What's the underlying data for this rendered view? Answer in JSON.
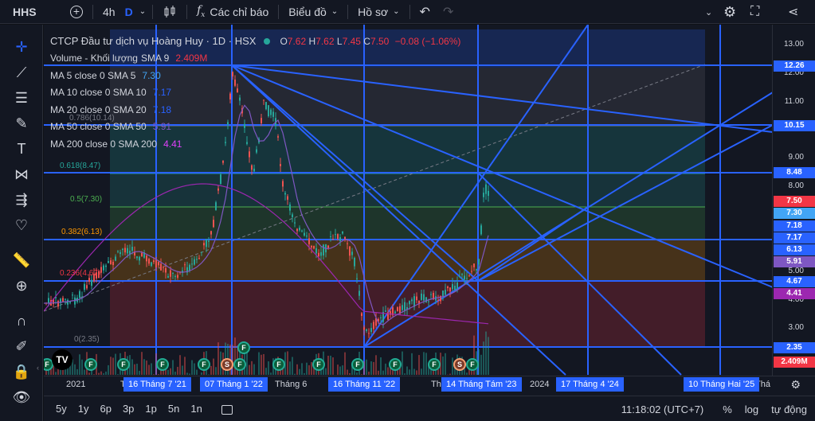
{
  "topbar": {
    "symbol": "HHS",
    "add_icon": "plus-circle-icon",
    "interval": "4h",
    "interval_d": "D",
    "indicators_label": "Các chỉ báo",
    "chart_type_label": "Biểu đồ",
    "profile_label": "Hồ sơ"
  },
  "legend": {
    "title": "CTCP Đầu tư dịch vụ Hoàng Huy · 1D · HSX",
    "ohlc": {
      "O": "7.62",
      "H": "7.62",
      "L": "7.45",
      "C": "7.50",
      "chg": "−0.08 (−1.06%)"
    },
    "volume": {
      "name": "Volume - Khối lượng",
      "sma": "SMA 9",
      "value": "2.409M"
    },
    "ma": [
      {
        "name": "MA 5 close 0 SMA 5",
        "value": "7.30",
        "color": "#42a5f5"
      },
      {
        "name": "MA 10 close 0 SMA 10",
        "value": "7.17",
        "color": "#2962ff"
      },
      {
        "name": "MA 20 close 0 SMA 20",
        "value": "7.18",
        "color": "#2962ff"
      },
      {
        "name": "MA 50 close 0 SMA 50",
        "value": "5.91",
        "color": "#7e57c2"
      },
      {
        "name": "MA 200 close 0 SMA 200",
        "value": "4.41",
        "color": "#e040fb"
      }
    ]
  },
  "fib_labels": {
    "f786": "0.786(10.14)",
    "f618": "0.618(8.47)",
    "f5": "0.5(7.30)",
    "f382": "0.382(6.13)",
    "f236": "0.236(4.67)",
    "f0": "0(2.35)"
  },
  "price_axis": {
    "ticks": [
      "13.00",
      "12.00",
      "11.00",
      "9.00",
      "8.00",
      "5.00",
      "4.00",
      "3.00"
    ],
    "tags": [
      {
        "text": "12.26",
        "color": "#2962ff"
      },
      {
        "text": "10.15",
        "color": "#2962ff"
      },
      {
        "text": "8.48",
        "color": "#2962ff"
      },
      {
        "text": "7.50",
        "color": "#f23645"
      },
      {
        "text": "7.30",
        "color": "#42a5f5"
      },
      {
        "text": "7.18",
        "color": "#2962ff"
      },
      {
        "text": "7.17",
        "color": "#2962ff"
      },
      {
        "text": "6.13",
        "color": "#2962ff"
      },
      {
        "text": "5.91",
        "color": "#7e57c2"
      },
      {
        "text": "4.67",
        "color": "#2962ff"
      },
      {
        "text": "4.41",
        "color": "#9c27b0"
      },
      {
        "text": "2.35",
        "color": "#2962ff"
      },
      {
        "text": "2.409M",
        "color": "#f23645"
      }
    ]
  },
  "time_axis": {
    "year_2021": "2021",
    "t_left": "T",
    "thang6": "Tháng 6",
    "t_mid": "Th",
    "year_2024": "2024",
    "t_right": "Thá",
    "boxes": [
      "16 Tháng 7 '21",
      "07 Tháng 1 '22",
      "16 Tháng 11 '22",
      "14 Tháng Tám '23",
      "17 Tháng 4 '24",
      "10 Tháng Hai '25"
    ]
  },
  "bottombar": {
    "ranges": [
      "5y",
      "1y",
      "6p",
      "3p",
      "1p",
      "5n",
      "1n"
    ],
    "time": "11:18:02 (UTC+7)",
    "percent": "%",
    "log": "log",
    "auto": "tự động"
  },
  "badges": {
    "f": "F",
    "s": "S",
    "logo": "TV"
  }
}
